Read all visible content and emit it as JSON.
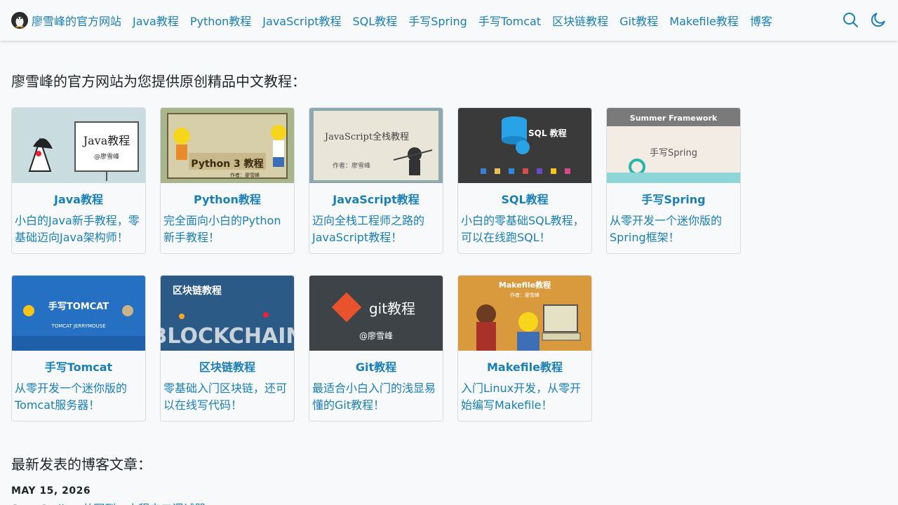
{
  "nav": {
    "brand": "廖雪峰的官方网站",
    "links": [
      "Java教程",
      "Python教程",
      "JavaScript教程",
      "SQL教程",
      "手写Spring",
      "手写Tomcat",
      "区块链教程",
      "Git教程",
      "Makefile教程",
      "博客"
    ],
    "icons": [
      "search-icon",
      "moon-icon"
    ]
  },
  "intro_title": "廖雪峰的官方网站为您提供原创精品中文教程：",
  "cards": [
    {
      "title": "Java教程",
      "desc": "小白的Java新手教程，零基础迈向Java架构师！",
      "img_text": "Java教程",
      "img_sub": "@廖雪峰"
    },
    {
      "title": "Python教程",
      "desc": "完全面向小白的Python新手教程！",
      "img_text": "Python 3 教程",
      "img_sub": "作者：廖雪峰"
    },
    {
      "title": "JavaScript教程",
      "desc": "迈向全栈工程师之路的JavaScript教程！",
      "img_text": "JavaScript全栈教程",
      "img_sub": "作者：廖雪峰"
    },
    {
      "title": "SQL教程",
      "desc": "小白的零基础SQL教程，可以在线跑SQL！",
      "img_text": "SQL 教程",
      "img_sub": ""
    },
    {
      "title": "手写Spring",
      "desc": "从零开发一个迷你版的Spring框架！",
      "img_text": "手写Spring",
      "img_sub": "Summer Framework"
    },
    {
      "title": "手写Tomcat",
      "desc": "从零开发一个迷你版的Tomcat服务器！",
      "img_text": "手写TOMCAT",
      "img_sub": "TOMCAT   JERRYMOUSE"
    },
    {
      "title": "区块链教程",
      "desc": "零基础入门区块链，还可以在线写代码！",
      "img_text": "区块链教程",
      "img_sub": "BLOCKCHAIN"
    },
    {
      "title": "Git教程",
      "desc": "最适合小白入门的浅显易懂的Git教程！",
      "img_text": "git教程",
      "img_sub": "@廖雪峰"
    },
    {
      "title": "Makefile教程",
      "desc": "入门Linux开发，从零开始编写Makefile！",
      "img_text": "Makefile教程",
      "img_sub": "作者：廖雪峰"
    }
  ],
  "blog_title": "最新发表的博客文章：",
  "latest_post": {
    "date": "MAY 15, 2026",
    "title": "SnapCoding 共写到一末程电二调试器"
  },
  "colors": {
    "link": "#1a7fb5",
    "background": "#f8f9fa",
    "text": "#212529"
  }
}
